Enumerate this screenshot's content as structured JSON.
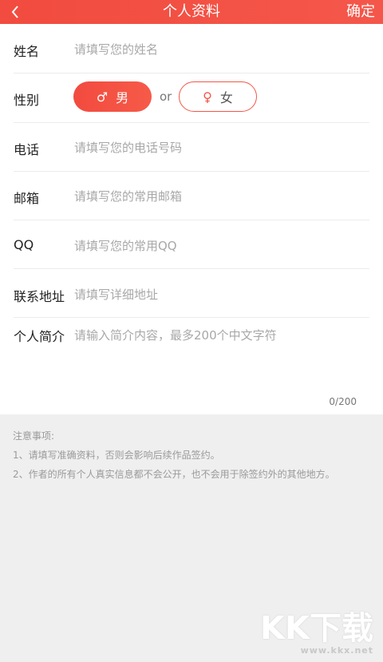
{
  "header": {
    "title": "个人资料",
    "confirm_label": "确定",
    "back_icon": "chevron-left-icon",
    "accent_color": "#f24b3f"
  },
  "form": {
    "name": {
      "label": "姓名",
      "placeholder": "请填写您的姓名"
    },
    "gender": {
      "label": "性别",
      "male_label": "男",
      "female_label": "女",
      "separator": "or",
      "selected": "male"
    },
    "phone": {
      "label": "电话",
      "placeholder": "请填写您的电话号码"
    },
    "email": {
      "label": "邮箱",
      "placeholder": "请填写您的常用邮箱"
    },
    "qq": {
      "label": "QQ",
      "placeholder": "请填写您的常用QQ"
    },
    "address": {
      "label": "联系地址",
      "placeholder": "请填写详细地址"
    },
    "bio": {
      "label": "个人简介",
      "placeholder": "请输入简介内容，最多200个中文字符",
      "counter": "0/200"
    }
  },
  "notes": {
    "title": "注意事项:",
    "items": [
      "1、请填写准确资料，否则会影响后续作品签约。",
      "2、作者的所有个人真实信息都不会公开，也不会用于除签约外的其他地方。"
    ]
  },
  "watermark": {
    "logo_text": "KK下载",
    "url": "www.kkx.net"
  }
}
